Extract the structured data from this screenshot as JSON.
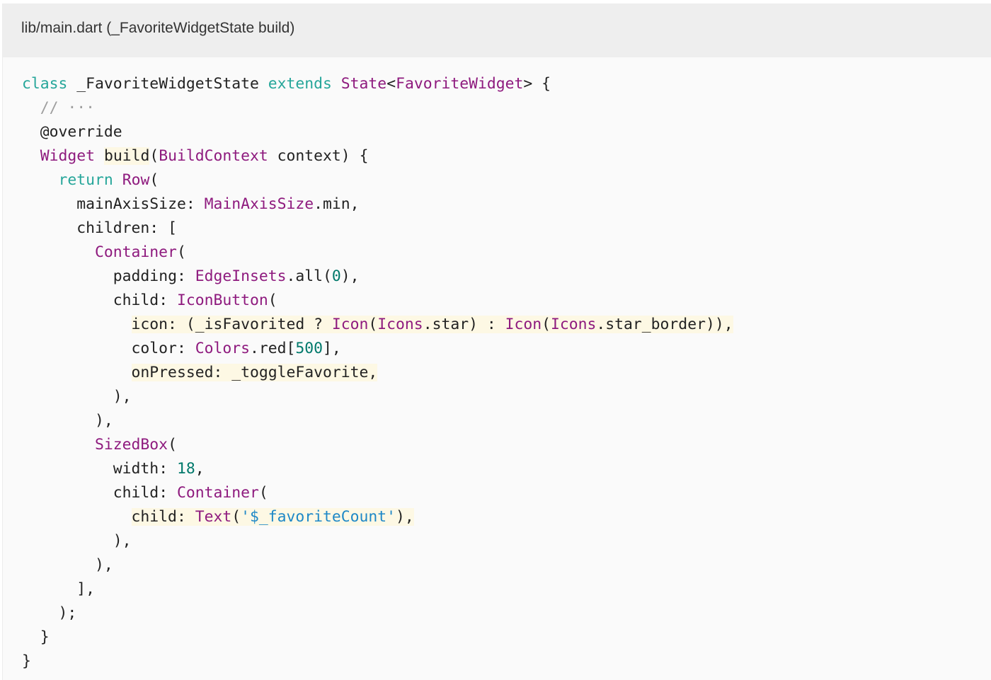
{
  "file_header": {
    "path": "lib/main.dart (_FavoriteWidgetState build)"
  },
  "code": {
    "lines": [
      {
        "indent": "",
        "tokens": [
          {
            "t": "class",
            "k": "kw"
          },
          {
            "t": " _FavoriteWidgetState ",
            "k": "plain"
          },
          {
            "t": "extends",
            "k": "kw"
          },
          {
            "t": " ",
            "k": "plain"
          },
          {
            "t": "State",
            "k": "type"
          },
          {
            "t": "<",
            "k": "plain"
          },
          {
            "t": "FavoriteWidget",
            "k": "type"
          },
          {
            "t": "> {",
            "k": "plain"
          }
        ]
      },
      {
        "indent": "  ",
        "tokens": [
          {
            "t": "// ···",
            "k": "cmt"
          }
        ]
      },
      {
        "indent": "  ",
        "tokens": [
          {
            "t": "@override",
            "k": "plain"
          }
        ]
      },
      {
        "indent": "  ",
        "tokens": [
          {
            "t": "Widget",
            "k": "type"
          },
          {
            "t": " ",
            "k": "plain"
          },
          {
            "t": "build",
            "k": "plain",
            "hl": true
          },
          {
            "t": "(",
            "k": "plain"
          },
          {
            "t": "BuildContext",
            "k": "type"
          },
          {
            "t": " context) {",
            "k": "plain"
          }
        ]
      },
      {
        "indent": "    ",
        "tokens": [
          {
            "t": "return",
            "k": "kw"
          },
          {
            "t": " ",
            "k": "plain"
          },
          {
            "t": "Row",
            "k": "type"
          },
          {
            "t": "(",
            "k": "plain"
          }
        ]
      },
      {
        "indent": "      ",
        "tokens": [
          {
            "t": "mainAxisSize: ",
            "k": "plain"
          },
          {
            "t": "MainAxisSize",
            "k": "type"
          },
          {
            "t": ".min,",
            "k": "plain"
          }
        ]
      },
      {
        "indent": "      ",
        "tokens": [
          {
            "t": "children: [",
            "k": "plain"
          }
        ]
      },
      {
        "indent": "        ",
        "tokens": [
          {
            "t": "Container",
            "k": "type"
          },
          {
            "t": "(",
            "k": "plain"
          }
        ]
      },
      {
        "indent": "          ",
        "tokens": [
          {
            "t": "padding: ",
            "k": "plain"
          },
          {
            "t": "EdgeInsets",
            "k": "type"
          },
          {
            "t": ".all(",
            "k": "plain"
          },
          {
            "t": "0",
            "k": "num"
          },
          {
            "t": "),",
            "k": "plain"
          }
        ]
      },
      {
        "indent": "          ",
        "tokens": [
          {
            "t": "child: ",
            "k": "plain"
          },
          {
            "t": "IconButton",
            "k": "type"
          },
          {
            "t": "(",
            "k": "plain"
          }
        ]
      },
      {
        "indent": "            ",
        "hl": true,
        "tokens": [
          {
            "t": "icon: (_isFavorited ? ",
            "k": "plain"
          },
          {
            "t": "Icon",
            "k": "type"
          },
          {
            "t": "(",
            "k": "plain"
          },
          {
            "t": "Icons",
            "k": "type"
          },
          {
            "t": ".star) : ",
            "k": "plain"
          },
          {
            "t": "Icon",
            "k": "type"
          },
          {
            "t": "(",
            "k": "plain"
          },
          {
            "t": "Icons",
            "k": "type"
          },
          {
            "t": ".star_border)),",
            "k": "plain"
          }
        ]
      },
      {
        "indent": "            ",
        "tokens": [
          {
            "t": "color: ",
            "k": "plain"
          },
          {
            "t": "Colors",
            "k": "type"
          },
          {
            "t": ".red[",
            "k": "plain"
          },
          {
            "t": "500",
            "k": "num"
          },
          {
            "t": "],",
            "k": "plain"
          }
        ]
      },
      {
        "indent": "            ",
        "hl": true,
        "tokens": [
          {
            "t": "onPressed: _toggleFavorite,",
            "k": "plain"
          }
        ]
      },
      {
        "indent": "          ",
        "tokens": [
          {
            "t": "),",
            "k": "plain"
          }
        ]
      },
      {
        "indent": "        ",
        "tokens": [
          {
            "t": "),",
            "k": "plain"
          }
        ]
      },
      {
        "indent": "        ",
        "tokens": [
          {
            "t": "SizedBox",
            "k": "type"
          },
          {
            "t": "(",
            "k": "plain"
          }
        ]
      },
      {
        "indent": "          ",
        "tokens": [
          {
            "t": "width: ",
            "k": "plain"
          },
          {
            "t": "18",
            "k": "num"
          },
          {
            "t": ",",
            "k": "plain"
          }
        ]
      },
      {
        "indent": "          ",
        "tokens": [
          {
            "t": "child: ",
            "k": "plain"
          },
          {
            "t": "Container",
            "k": "type"
          },
          {
            "t": "(",
            "k": "plain"
          }
        ]
      },
      {
        "indent": "            ",
        "hl": true,
        "tokens": [
          {
            "t": "child: ",
            "k": "plain"
          },
          {
            "t": "Text",
            "k": "type"
          },
          {
            "t": "(",
            "k": "plain"
          },
          {
            "t": "'$_favoriteCount'",
            "k": "str"
          },
          {
            "t": "),",
            "k": "plain"
          }
        ]
      },
      {
        "indent": "          ",
        "tokens": [
          {
            "t": "),",
            "k": "plain"
          }
        ]
      },
      {
        "indent": "        ",
        "tokens": [
          {
            "t": "),",
            "k": "plain"
          }
        ]
      },
      {
        "indent": "      ",
        "tokens": [
          {
            "t": "],",
            "k": "plain"
          }
        ]
      },
      {
        "indent": "    ",
        "tokens": [
          {
            "t": ");",
            "k": "plain"
          }
        ]
      },
      {
        "indent": "  ",
        "tokens": [
          {
            "t": "}",
            "k": "plain"
          }
        ]
      },
      {
        "indent": "",
        "tokens": [
          {
            "t": "}",
            "k": "plain"
          }
        ]
      }
    ]
  },
  "colors": {
    "keyword": "#26a69a",
    "type": "#8e1a7e",
    "number": "#00796b",
    "string": "#1e88c7",
    "comment": "#9e9e9e",
    "highlight": "#fdf8e4",
    "header_bg": "#eeeeee",
    "code_bg": "#fafafa"
  }
}
